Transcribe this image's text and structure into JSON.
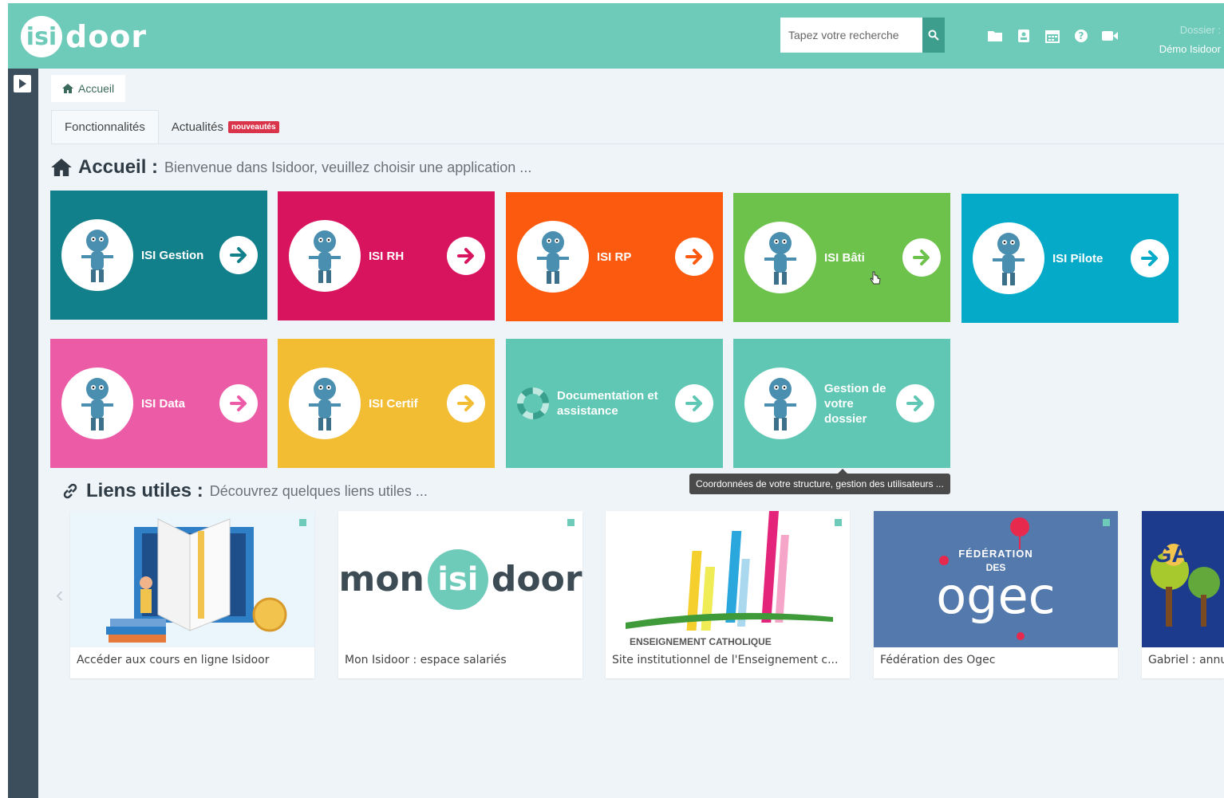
{
  "header": {
    "logo_circle": "isi",
    "logo_rest": "door",
    "search_placeholder": "Tapez votre recherche",
    "dossier_label": "Dossier :",
    "dossier_value": "Démo Isidoor",
    "icons": [
      "folder-icon",
      "contact-card-icon",
      "calendar-icon",
      "help-icon",
      "video-icon"
    ]
  },
  "breadcrumb": {
    "label": "Accueil"
  },
  "tabs": [
    {
      "label": "Fonctionnalités"
    },
    {
      "label": "Actualités",
      "badge": "nouveautés"
    }
  ],
  "accueil": {
    "title": "Accueil :",
    "subtitle": "Bienvenue dans Isidoor, veuillez choisir une application ..."
  },
  "apps": [
    {
      "label": "ISI Gestion",
      "color": "#12808a"
    },
    {
      "label": "ISI RH",
      "color": "#d8145f"
    },
    {
      "label": "ISI RP",
      "color": "#fb5a0f"
    },
    {
      "label": "ISI Bâti",
      "color": "#6cc24a"
    },
    {
      "label": "ISI Pilote",
      "color": "#06aac9"
    },
    {
      "label": "ISI Data",
      "color": "#ec5ca6"
    },
    {
      "label": "ISI Certif",
      "color": "#f2bd33"
    },
    {
      "label": "Documentation et assistance",
      "color": "#5fc7b3"
    },
    {
      "label": "Gestion de votre dossier",
      "color": "#5fc7b3"
    }
  ],
  "tooltip": "Coordonnées de votre structure, gestion des utilisateurs ...",
  "liens": {
    "title": "Liens utiles :",
    "subtitle": "Découvrez quelques liens utiles ...",
    "cards": [
      {
        "caption": "Accéder aux cours en ligne Isidoor"
      },
      {
        "caption": "Mon Isidoor : espace salariés",
        "logo_left": "mon",
        "logo_mid": "isi",
        "logo_right": "door"
      },
      {
        "caption": "Site institutionnel de l'Enseignement c...",
        "logo_text": "ENSEIGNEMENT CATHOLIQUE"
      },
      {
        "caption": "Fédération des Ogec",
        "logo_top": "FÉDÉRATION",
        "logo_mid": "DES",
        "logo_main": "ogec"
      },
      {
        "caption": "Gabriel : annu",
        "logo_text": "GA"
      }
    ]
  }
}
